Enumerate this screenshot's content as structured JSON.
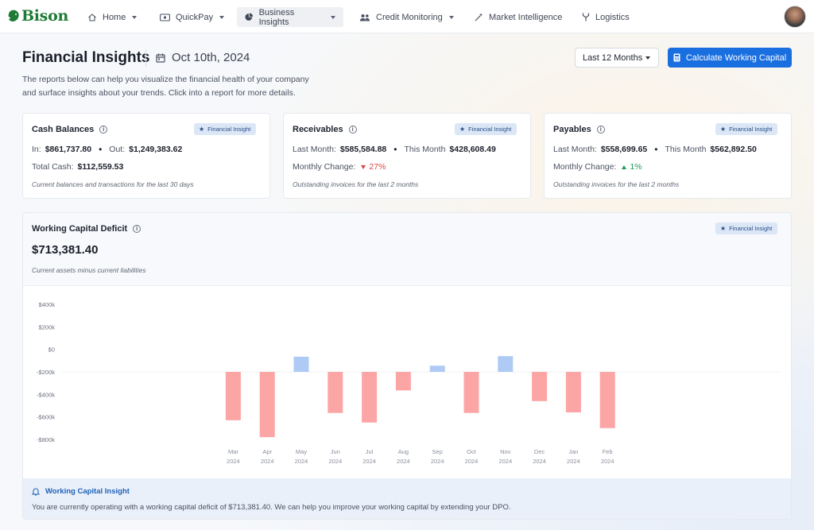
{
  "brand": {
    "name": "Bison"
  },
  "nav": {
    "items": [
      {
        "label": "Home",
        "icon": "home-icon",
        "dropdown": true
      },
      {
        "label": "QuickPay",
        "icon": "cash-icon",
        "dropdown": true
      },
      {
        "label": "Business Insights",
        "icon": "pie-chart-icon",
        "dropdown": true,
        "active": true
      },
      {
        "label": "Credit Monitoring",
        "icon": "users-icon",
        "dropdown": true
      },
      {
        "label": "Market Intelligence",
        "icon": "sparkle-icon",
        "dropdown": false
      },
      {
        "label": "Logistics",
        "icon": "fork-icon",
        "dropdown": false
      }
    ]
  },
  "header": {
    "title": "Financial Insights",
    "date": "Oct 10th, 2024",
    "intro": "The reports below can help you visualize the financial health of your company and surface insights about your trends. Click into a report for more details.",
    "period": "Last 12 Months",
    "calc_button": "Calculate Working Capital"
  },
  "badge_label": "Financial Insight",
  "cards": {
    "cash": {
      "title": "Cash Balances",
      "in_label": "In:",
      "in_value": "$861,737.80",
      "out_label": "Out:",
      "out_value": "$1,249,383.62",
      "total_label": "Total Cash:",
      "total_value": "$112,559.53",
      "caption": "Current balances and transactions for the last 30 days"
    },
    "receivables": {
      "title": "Receivables",
      "last_label": "Last Month:",
      "last_value": "$585,584.88",
      "this_label": "This Month",
      "this_value": "$428,608.49",
      "change_label": "Monthly Change:",
      "change_value": "27%",
      "caption": "Outstanding invoices for the last 2 months"
    },
    "payables": {
      "title": "Payables",
      "last_label": "Last Month:",
      "last_value": "$558,699.65",
      "this_label": "This Month",
      "this_value": "$562,892.50",
      "change_label": "Monthly Change:",
      "change_value": "1%",
      "caption": "Outstanding invoices for the last 2 months"
    }
  },
  "deficit": {
    "title": "Working Capital Deficit",
    "value": "$713,381.40",
    "caption": "Current assets minus current liabilities"
  },
  "chart_data": {
    "type": "bar",
    "subtype": "floating-bar",
    "title": "",
    "xlabel": "",
    "ylabel": "",
    "categories": [
      "Mar 2024",
      "Apr 2024",
      "May 2024",
      "Jun 2024",
      "Jul 2024",
      "Aug 2024",
      "Sep 2024",
      "Oct 2024",
      "Nov 2024",
      "Dec 2024",
      "Jan 2024",
      "Feb 2024"
    ],
    "baseline": -200000,
    "values": [
      -630000,
      -780000,
      -65000,
      -565000,
      -650000,
      -365000,
      -145000,
      -565000,
      -60000,
      -460000,
      -560000,
      -700000
    ],
    "ylim": [
      -800000,
      400000
    ],
    "yticks": [
      400000,
      200000,
      0,
      -200000,
      -400000,
      -600000,
      -800000
    ],
    "ytick_labels": [
      "$400k",
      "$200k",
      "$0",
      "-$200k",
      "-$400k",
      "-$600k",
      "-$800k"
    ],
    "colors": {
      "below": "#fca5a5",
      "above": "#afcbf5"
    },
    "grid": false,
    "legend": "none"
  },
  "insight": {
    "title": "Working Capital Insight",
    "text": "You are currently operating with a working capital deficit of $713,381.40. We can help you improve your working capital by extending your DPO."
  },
  "colors": {
    "accent": "#1a6fe0",
    "brand": "#1f7a35",
    "negative": "#e0443e",
    "positive": "#1f9a56"
  }
}
